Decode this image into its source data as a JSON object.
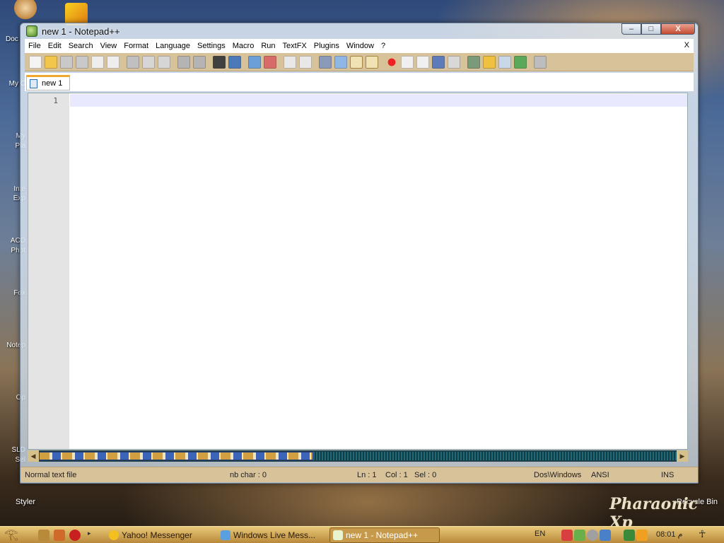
{
  "desktop": {
    "top_icon_label": "Doc",
    "left_labels": [
      "My C",
      "My",
      "Pla",
      "Inte",
      "Exp",
      "ACD",
      "Phot",
      "Fox",
      "Notep",
      "Op",
      "SLD",
      "Sel"
    ],
    "bottom_left_label": "Styler",
    "recycle_bin_label": "Recycle Bin",
    "brand_text": "Pharaonic Xp"
  },
  "window": {
    "title": "new 1 - Notepad++",
    "controls": {
      "minimize": "–",
      "maximize": "□",
      "close": "X"
    }
  },
  "menu": {
    "items": [
      "File",
      "Edit",
      "Search",
      "View",
      "Format",
      "Language",
      "Settings",
      "Macro",
      "Run",
      "TextFX",
      "Plugins",
      "Window",
      "?"
    ],
    "close_label": "X"
  },
  "toolbar": {
    "icons": [
      "new-file-icon",
      "open-file-icon",
      "save-icon",
      "save-all-icon",
      "close-icon",
      "close-all-icon",
      "cut-icon",
      "copy-icon",
      "paste-icon",
      "undo-icon",
      "redo-icon",
      "find-icon",
      "replace-icon",
      "zoom-in-icon",
      "zoom-out-icon",
      "sync-vertical-icon",
      "sync-horizontal-icon",
      "word-wrap-icon",
      "show-all-chars-icon",
      "indent-guide-icon",
      "user-lang-icon",
      "record-macro-icon",
      "stop-macro-icon",
      "play-macro-icon",
      "run-macro-multiple-icon",
      "save-macro-icon",
      "open-folder-icon",
      "folder-icon",
      "console-icon",
      "spell-check-icon",
      "print-icon"
    ]
  },
  "tabs": [
    {
      "label": "new 1"
    }
  ],
  "editor": {
    "line_numbers": [
      "1"
    ]
  },
  "status": {
    "file_type": "Normal text file",
    "nb_char": "nb char : 0",
    "ln": "Ln : 1",
    "col": "Col : 1",
    "sel": "Sel : 0",
    "eol": "Dos\\Windows",
    "encoding": "ANSI",
    "mode": "INS"
  },
  "taskbar": {
    "tasks": [
      {
        "label": "Yahoo! Messenger",
        "active": false
      },
      {
        "label": "Windows Live Mess...",
        "active": false
      },
      {
        "label": "new 1 - Notepad++",
        "active": true
      }
    ],
    "language": "EN",
    "clock": "08:01 ﻡ"
  },
  "colors": {
    "toolbar_bg": "#d8c29a",
    "taskbar_bg": "#c69a4a",
    "current_line": "#e8e8ff"
  }
}
